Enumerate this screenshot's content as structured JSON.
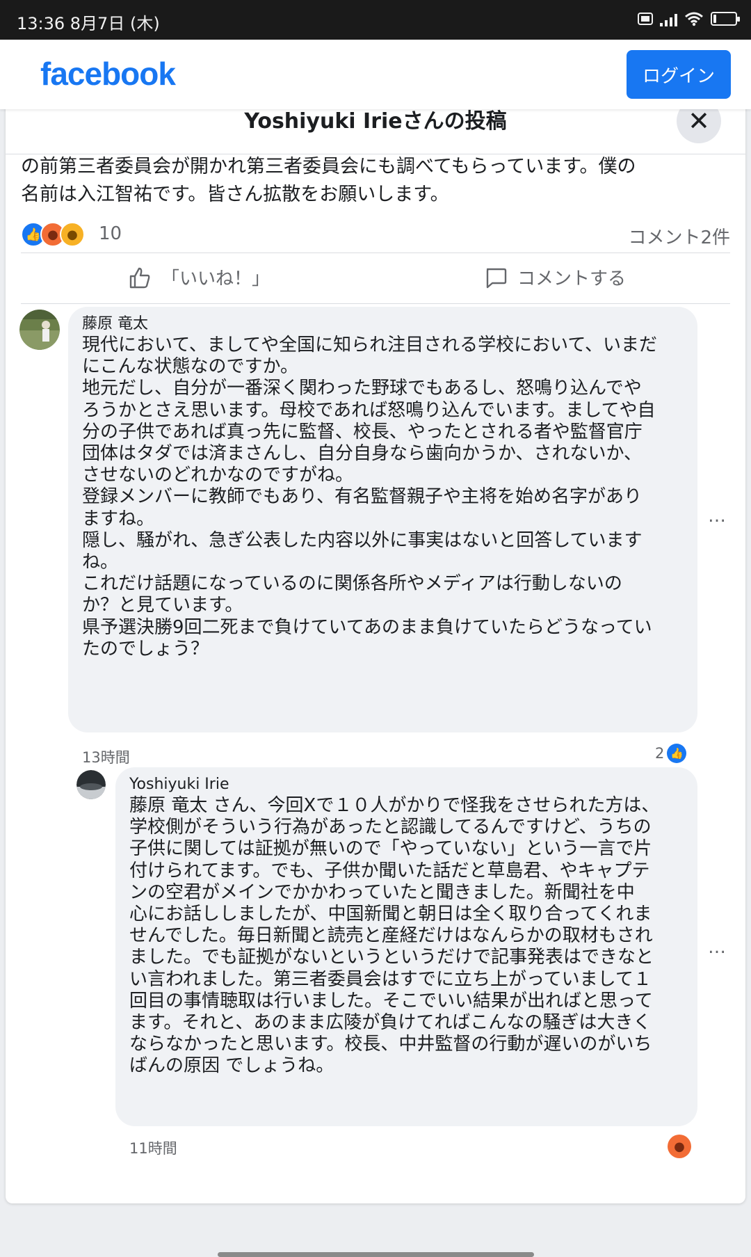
{
  "status_bar": {
    "time_date": "13:36  8月7日 (木)",
    "battery": "11"
  },
  "header": {
    "logo": "facebook",
    "login_label": "ログイン"
  },
  "modal": {
    "title": "Yoshiyuki Irieさんの投稿",
    "close_symbol": "✕"
  },
  "post": {
    "text": "の前第三者委員会が開かれ第三者委員会にも調べてもらっています。僕の\n名前は入江智祐です。皆さん拡散をお願いします。",
    "reaction_count": "10",
    "comment_count": "コメント2件",
    "like_action": "「いいね！」",
    "comment_action": "コメントする"
  },
  "comments": [
    {
      "author": "藤原 竜太",
      "text": "現代において、ましてや全国に知られ注目される学校において、いまだ\nにこんな状態なのですか。\n地元だし、自分が一番深く関わった野球でもあるし、怒鳴り込んでや\nろうかとさえ思います。母校であれば怒鳴り込んでいます。ましてや自\n分の子供であれば真っ先に監督、校長、やったとされる者や監督官庁\n団体はタダでは済まさんし、自分自身なら歯向かうか、されないか、\nさせないのどれかなのですがね。\n登録メンバーに教師でもあり、有名監督親子や主将を始め名字があり\nますね。\n隠し、騒がれ、急ぎ公表した内容以外に事実はないと回答しています\nね。\nこれだけ話題になっているのに関係各所やメディアは行動しないの\nか？と見ています。\n県予選決勝9回二死まで負けていてあのまま負けていたらどうなってい\nたのでしょう？",
      "time": "13時間",
      "likes": "2",
      "more": "…"
    },
    {
      "author": "Yoshiyuki Irie",
      "text": "藤原 竜太 さん、今回Xで１０人がかりで怪我をさせられた方は、\n学校側がそういう行為があったと認識してるんですけど、うちの\n子供に関しては証拠が無いので「やっていない」という一言で片\n付けられてます。でも、子供か聞いた話だと草島君、やキャプテ\nンの空君がメインでかかわっていたと聞きました。新聞社を中\n心にお話ししましたが、中国新聞と朝日は全く取り合ってくれま\nせんでした。毎日新聞と読売と産経だけはなんらかの取材もされ\nました。でも証拠がないというというだけで記事発表はできなと\nい言われました。第三者委員会はすでに立ち上がっていまして１\n回目の事情聴取は行いました。そこでいい結果が出ればと思って\nます。それと、あのまま広陵が負けてればこんなの騒ぎは大きく\nならなかったと思います。校長、中井監督の行動が遅いのがいち\nばんの原因 でしょうね。",
      "time": "11時間",
      "more": "…"
    }
  ]
}
